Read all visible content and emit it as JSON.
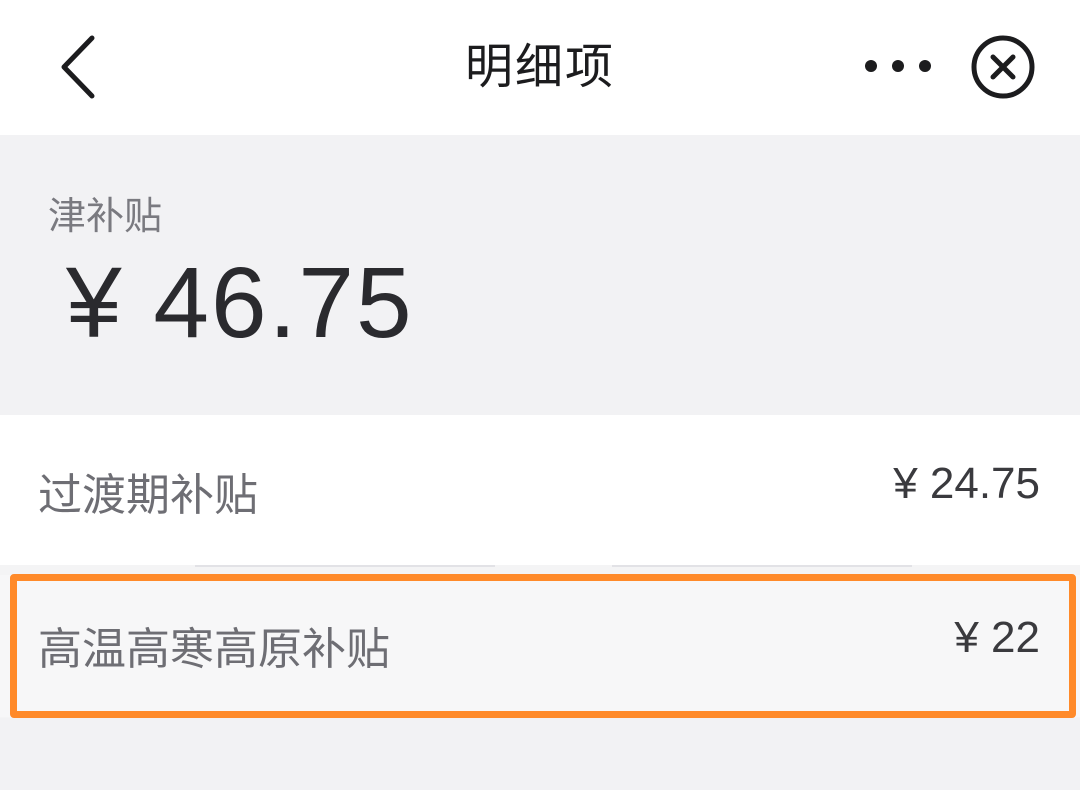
{
  "nav": {
    "title": "明细项",
    "back_icon": "chevron-left-icon",
    "more_icon": "more-horizontal-icon",
    "close_icon": "close-circle-icon"
  },
  "summary": {
    "label": "津补贴",
    "amount": "¥ 46.75"
  },
  "items": [
    {
      "label": "过渡期补贴",
      "value": "¥ 24.75"
    },
    {
      "label": "高温高寒高原补贴",
      "value": "¥ 22"
    }
  ],
  "colors": {
    "highlight": "#ff8a2a",
    "background": "#f4f4f5"
  }
}
